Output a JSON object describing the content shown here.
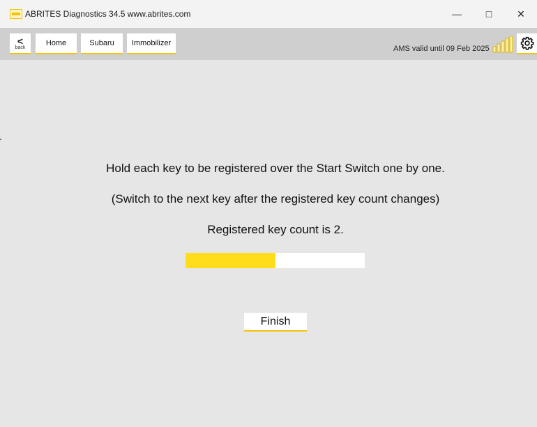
{
  "window": {
    "title": "ABRITES Diagnostics 34.5   www.abrites.com",
    "minimize_glyph": "—",
    "maximize_glyph": "□",
    "close_glyph": "✕"
  },
  "toolbar": {
    "back_glyph": "<",
    "back_label": "back",
    "breadcrumbs": [
      "Home",
      "Subaru",
      "Immobilizer"
    ],
    "ams_status": "AMS valid until 09 Feb 2025",
    "signal_icon": "signal-strength-icon",
    "settings_icon": "gear-icon"
  },
  "main": {
    "instruction": "Hold each key to be registered over the Start Switch one by one.",
    "hint": "(Switch to the next key after the registered key count changes)",
    "status": "Registered key count is 2.",
    "progress_fraction": 0.5,
    "finish_label": "Finish"
  },
  "colors": {
    "accent": "#ffdd1a",
    "accent_line": "#f2c40c",
    "background": "#e6e6e6",
    "toolbar": "#cfcfcf"
  }
}
